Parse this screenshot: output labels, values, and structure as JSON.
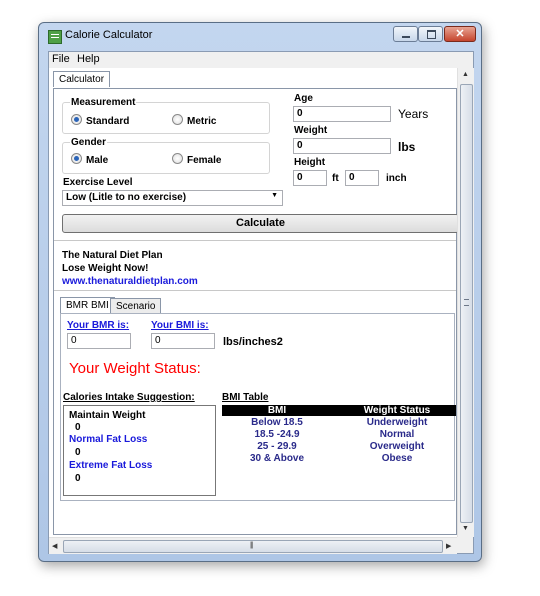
{
  "window": {
    "title": "Calorie Calculator"
  },
  "menu": {
    "file": "File",
    "help": "Help"
  },
  "tabs_top": [
    {
      "label": "Calculator"
    }
  ],
  "measurement": {
    "label": "Measurement",
    "options": [
      "Standard",
      "Metric"
    ],
    "selected": "Standard"
  },
  "gender": {
    "label": "Gender",
    "options": [
      "Male",
      "Female"
    ],
    "selected": "Male"
  },
  "exercise": {
    "label": "Exercise Level",
    "value": "Low (Litle to no exercise)"
  },
  "age": {
    "label": "Age",
    "value": "0",
    "unit": "Years"
  },
  "weight": {
    "label": "Weight",
    "value": "0",
    "unit": "lbs"
  },
  "height": {
    "label": "Height",
    "feet": "0",
    "feet_unit": "ft",
    "inches": "0",
    "inch_unit": "inch"
  },
  "calculate_label": "Calculate",
  "promo": {
    "line1": "The Natural Diet Plan",
    "line2": "Lose Weight Now!",
    "url": "www.thenaturaldietplan.com"
  },
  "tabs_bottom": [
    {
      "label": "BMR BMI"
    },
    {
      "label": "Scenario"
    }
  ],
  "bmr": {
    "label": "Your BMR is:",
    "value": "0"
  },
  "bmi": {
    "label": "Your BMI is:",
    "value": "0",
    "unit": "lbs/inches2"
  },
  "weight_status_label": "Your Weight Status:",
  "calories": {
    "title": "Calories Intake Suggestion:",
    "maintain_label": "Maintain Weight",
    "maintain_value": "0",
    "normal_label": "Normal Fat Loss",
    "normal_value": "0",
    "extreme_label": "Extreme Fat Loss",
    "extreme_value": "0"
  },
  "bmi_table": {
    "title": "BMI Table",
    "headers": [
      "BMI",
      "Weight Status"
    ],
    "rows": [
      [
        "Below 18.5",
        "Underweight"
      ],
      [
        "18.5 -24.9",
        "Normal"
      ],
      [
        "25 - 29.9",
        "Overweight"
      ],
      [
        "30 & Above",
        "Obese"
      ]
    ]
  },
  "icons": {
    "app": "calculator-app-icon",
    "minimize": "minimize-icon",
    "maximize": "maximize-icon",
    "close": "close-icon"
  }
}
